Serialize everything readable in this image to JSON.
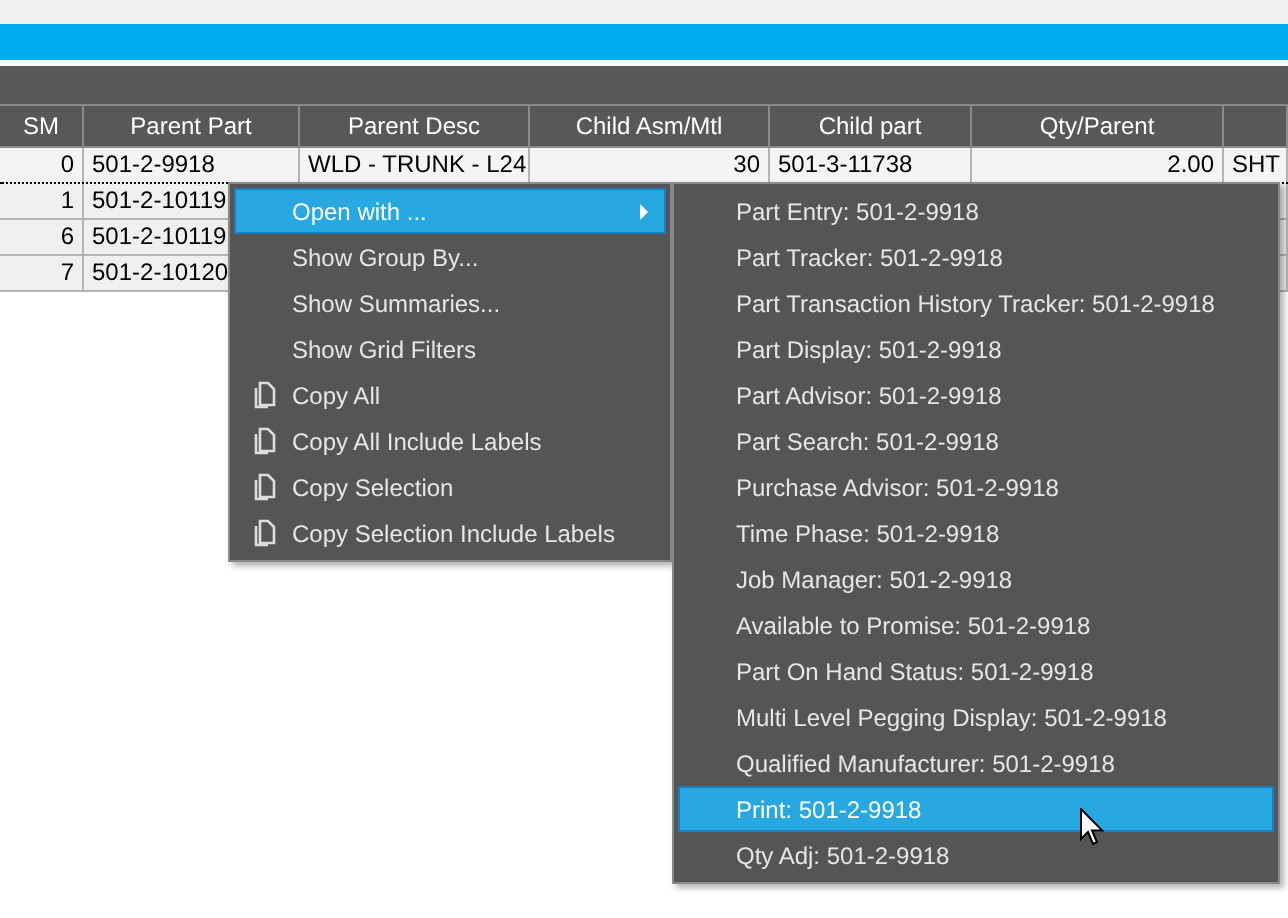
{
  "table": {
    "columns": [
      "SM",
      "Parent Part",
      "Parent Desc",
      "Child Asm/Mtl",
      "Child part",
      "Qty/Parent"
    ],
    "rows": [
      {
        "focused": true,
        "cells": [
          "0",
          "501-2-9918",
          "WLD - TRUNK - L24",
          "30",
          "501-3-11738",
          "2.00",
          "SHT"
        ]
      },
      {
        "focused": false,
        "cells": [
          "1",
          "501-2-10119"
        ]
      },
      {
        "focused": false,
        "cells": [
          "6",
          "501-2-10119"
        ]
      },
      {
        "focused": false,
        "cells": [
          "7",
          "501-2-10120"
        ]
      }
    ]
  },
  "context_menu": {
    "items": [
      {
        "kind": "submenu",
        "label": "Open with ...",
        "selected": true
      },
      {
        "kind": "plain",
        "label": "Show Group By...",
        "selected": false
      },
      {
        "kind": "plain",
        "label": "Show Summaries...",
        "selected": false
      },
      {
        "kind": "plain",
        "label": "Show Grid Filters",
        "selected": false
      },
      {
        "kind": "copy",
        "label": "Copy All",
        "selected": false
      },
      {
        "kind": "copy",
        "label": "Copy All Include Labels",
        "selected": false
      },
      {
        "kind": "copy",
        "label": "Copy Selection",
        "selected": false
      },
      {
        "kind": "copy",
        "label": "Copy Selection Include Labels",
        "selected": false
      }
    ]
  },
  "submenu": {
    "items": [
      {
        "label": "Part Entry: 501-2-9918",
        "selected": false
      },
      {
        "label": "Part Tracker: 501-2-9918",
        "selected": false
      },
      {
        "label": "Part Transaction History Tracker: 501-2-9918",
        "selected": false
      },
      {
        "label": "Part Display: 501-2-9918",
        "selected": false
      },
      {
        "label": "Part Advisor: 501-2-9918",
        "selected": false
      },
      {
        "label": "Part Search: 501-2-9918",
        "selected": false
      },
      {
        "label": "Purchase Advisor: 501-2-9918",
        "selected": false
      },
      {
        "label": "Time Phase: 501-2-9918",
        "selected": false
      },
      {
        "label": "Job Manager: 501-2-9918",
        "selected": false
      },
      {
        "label": "Available to Promise: 501-2-9918",
        "selected": false
      },
      {
        "label": "Part On Hand Status: 501-2-9918",
        "selected": false
      },
      {
        "label": "Multi Level Pegging Display: 501-2-9918",
        "selected": false
      },
      {
        "label": "Qualified Manufacturer: 501-2-9918",
        "selected": false
      },
      {
        "label": "Print: 501-2-9918",
        "selected": true
      },
      {
        "label": "Qty Adj: 501-2-9918",
        "selected": false
      }
    ]
  }
}
